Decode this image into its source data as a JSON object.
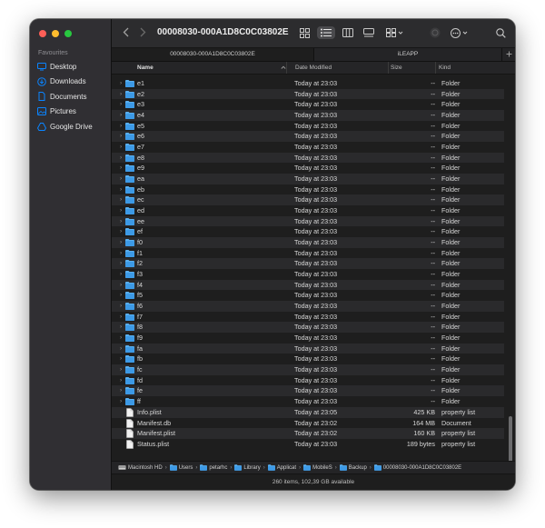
{
  "window": {
    "title": "00008030-000A1D8C0C03802E"
  },
  "sidebar": {
    "section_title": "Favourites",
    "items": [
      {
        "label": "Desktop",
        "icon": "desktop-icon"
      },
      {
        "label": "Downloads",
        "icon": "downloads-icon"
      },
      {
        "label": "Documents",
        "icon": "documents-icon"
      },
      {
        "label": "Pictures",
        "icon": "pictures-icon"
      },
      {
        "label": "Google Drive",
        "icon": "google-drive-icon"
      }
    ]
  },
  "tabs": [
    {
      "label": "00008030-000A1D8C0C03802E"
    },
    {
      "label": "iLEAPP"
    }
  ],
  "columns": {
    "name": "Name",
    "date": "Date Modified",
    "size": "Size",
    "kind": "Kind"
  },
  "rows": [
    {
      "name": "e1",
      "date": "Today at 23:03",
      "size": "--",
      "kind": "Folder",
      "type": "folder"
    },
    {
      "name": "e2",
      "date": "Today at 23:03",
      "size": "--",
      "kind": "Folder",
      "type": "folder"
    },
    {
      "name": "e3",
      "date": "Today at 23:03",
      "size": "--",
      "kind": "Folder",
      "type": "folder"
    },
    {
      "name": "e4",
      "date": "Today at 23:03",
      "size": "--",
      "kind": "Folder",
      "type": "folder"
    },
    {
      "name": "e5",
      "date": "Today at 23:03",
      "size": "--",
      "kind": "Folder",
      "type": "folder"
    },
    {
      "name": "e6",
      "date": "Today at 23:03",
      "size": "--",
      "kind": "Folder",
      "type": "folder"
    },
    {
      "name": "e7",
      "date": "Today at 23:03",
      "size": "--",
      "kind": "Folder",
      "type": "folder"
    },
    {
      "name": "e8",
      "date": "Today at 23:03",
      "size": "--",
      "kind": "Folder",
      "type": "folder"
    },
    {
      "name": "e9",
      "date": "Today at 23:03",
      "size": "--",
      "kind": "Folder",
      "type": "folder"
    },
    {
      "name": "ea",
      "date": "Today at 23:03",
      "size": "--",
      "kind": "Folder",
      "type": "folder"
    },
    {
      "name": "eb",
      "date": "Today at 23:03",
      "size": "--",
      "kind": "Folder",
      "type": "folder"
    },
    {
      "name": "ec",
      "date": "Today at 23:03",
      "size": "--",
      "kind": "Folder",
      "type": "folder"
    },
    {
      "name": "ed",
      "date": "Today at 23:03",
      "size": "--",
      "kind": "Folder",
      "type": "folder"
    },
    {
      "name": "ee",
      "date": "Today at 23:03",
      "size": "--",
      "kind": "Folder",
      "type": "folder"
    },
    {
      "name": "ef",
      "date": "Today at 23:03",
      "size": "--",
      "kind": "Folder",
      "type": "folder"
    },
    {
      "name": "f0",
      "date": "Today at 23:03",
      "size": "--",
      "kind": "Folder",
      "type": "folder"
    },
    {
      "name": "f1",
      "date": "Today at 23:03",
      "size": "--",
      "kind": "Folder",
      "type": "folder"
    },
    {
      "name": "f2",
      "date": "Today at 23:03",
      "size": "--",
      "kind": "Folder",
      "type": "folder"
    },
    {
      "name": "f3",
      "date": "Today at 23:03",
      "size": "--",
      "kind": "Folder",
      "type": "folder"
    },
    {
      "name": "f4",
      "date": "Today at 23:03",
      "size": "--",
      "kind": "Folder",
      "type": "folder"
    },
    {
      "name": "f5",
      "date": "Today at 23:03",
      "size": "--",
      "kind": "Folder",
      "type": "folder"
    },
    {
      "name": "f6",
      "date": "Today at 23:03",
      "size": "--",
      "kind": "Folder",
      "type": "folder"
    },
    {
      "name": "f7",
      "date": "Today at 23:03",
      "size": "--",
      "kind": "Folder",
      "type": "folder"
    },
    {
      "name": "f8",
      "date": "Today at 23:03",
      "size": "--",
      "kind": "Folder",
      "type": "folder"
    },
    {
      "name": "f9",
      "date": "Today at 23:03",
      "size": "--",
      "kind": "Folder",
      "type": "folder"
    },
    {
      "name": "fa",
      "date": "Today at 23:03",
      "size": "--",
      "kind": "Folder",
      "type": "folder"
    },
    {
      "name": "fb",
      "date": "Today at 23:03",
      "size": "--",
      "kind": "Folder",
      "type": "folder"
    },
    {
      "name": "fc",
      "date": "Today at 23:03",
      "size": "--",
      "kind": "Folder",
      "type": "folder"
    },
    {
      "name": "fd",
      "date": "Today at 23:03",
      "size": "--",
      "kind": "Folder",
      "type": "folder"
    },
    {
      "name": "fe",
      "date": "Today at 23:03",
      "size": "--",
      "kind": "Folder",
      "type": "folder"
    },
    {
      "name": "ff",
      "date": "Today at 23:03",
      "size": "--",
      "kind": "Folder",
      "type": "folder"
    },
    {
      "name": "Info.plist",
      "date": "Today at 23:05",
      "size": "425 KB",
      "kind": "property list",
      "type": "file"
    },
    {
      "name": "Manifest.db",
      "date": "Today at 23:02",
      "size": "164 MB",
      "kind": "Document",
      "type": "file"
    },
    {
      "name": "Manifest.plist",
      "date": "Today at 23:02",
      "size": "160 KB",
      "kind": "property list",
      "type": "file"
    },
    {
      "name": "Status.plist",
      "date": "Today at 23:03",
      "size": "189 bytes",
      "kind": "property list",
      "type": "file"
    }
  ],
  "pathbar": [
    {
      "label": "Macintosh HD",
      "icon": "disk-icon"
    },
    {
      "label": "Users",
      "icon": "folder-icon"
    },
    {
      "label": "petarhc",
      "icon": "folder-icon"
    },
    {
      "label": "Library",
      "icon": "folder-icon"
    },
    {
      "label": "Applicat",
      "icon": "folder-icon"
    },
    {
      "label": "MobileS",
      "icon": "folder-icon"
    },
    {
      "label": "Backup",
      "icon": "folder-icon"
    },
    {
      "label": "00008030-000A1D8C0C03802E",
      "icon": "folder-icon"
    }
  ],
  "status": "260 items, 102,39 GB available",
  "colors": {
    "accent": "#0a84ff",
    "folder": "#5ab0f0"
  }
}
